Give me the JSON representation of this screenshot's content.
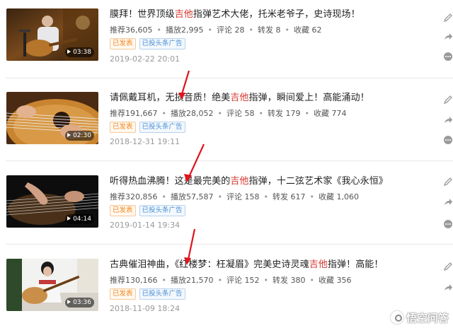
{
  "articles": [
    {
      "title_pre": "膜拜！世界顶级",
      "title_hl": "吉他",
      "title_post": "指弹艺术大佬，托米老爷子，史诗现场！",
      "duration": "03:38",
      "recommend": "推荐36,605",
      "plays": "播放2,995",
      "comments": "评论 28",
      "shares": "转发 8",
      "favorites": "收藏 62",
      "tag_published": "已发表",
      "tag_ad": "已投头条广告",
      "date": "2019-02-22 20:01"
    },
    {
      "title_pre": "请佩戴耳机，无损音质！绝美",
      "title_hl": "吉他",
      "title_post": "指弹，瞬间爱上！高能涌动！",
      "duration": "02:30",
      "recommend": "推荐191,667",
      "plays": "播放28,052",
      "comments": "评论 58",
      "shares": "转发 179",
      "favorites": "收藏 774",
      "tag_published": "已发表",
      "tag_ad": "已投头条广告",
      "date": "2018-12-31 19:11"
    },
    {
      "title_pre": "听得热血沸腾！这是最完美的",
      "title_hl": "吉他",
      "title_post": "指弹，十二弦艺术家《我心永恒》",
      "duration": "04:14",
      "recommend": "推荐320,856",
      "plays": "播放57,587",
      "comments": "评论 158",
      "shares": "转发 617",
      "favorites": "收藏 1,060",
      "tag_published": "已发表",
      "tag_ad": "已投头条广告",
      "date": "2019-01-14 19:34"
    },
    {
      "title_pre": "古典催泪神曲，《红楼梦：枉凝眉》完美史诗灵魂",
      "title_hl": "吉他",
      "title_post": "指弹！高能！",
      "duration": "03:36",
      "recommend": "推荐130,166",
      "plays": "播放21,570",
      "comments": "评论 152",
      "shares": "转发 380",
      "favorites": "收藏 356",
      "tag_published": "已发表",
      "tag_ad": "已投头条广告",
      "date": "2018-11-09 18:24"
    }
  ],
  "watermark": "悟空问答",
  "colors": {
    "highlight": "#d6332d",
    "published": "#f08a24",
    "ad": "#4a8fd4",
    "arrow": "#e0141e"
  },
  "icons": [
    "edit-icon",
    "share-icon",
    "more-icon",
    "play-icon",
    "red-arrow-annotation"
  ]
}
